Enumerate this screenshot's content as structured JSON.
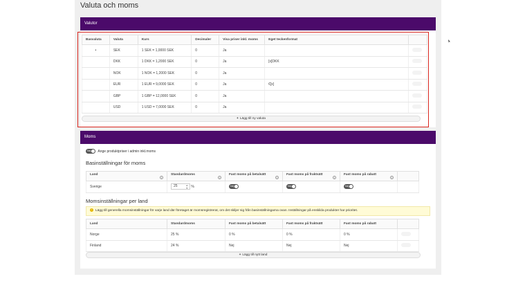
{
  "page": {
    "title": "Valuta och moms"
  },
  "valutor": {
    "header": "Valutor",
    "columns": [
      "Basvaluta",
      "Valuta",
      "Kurs",
      "Decimaler",
      "Visa priser inkl. moms",
      "Eget teckenformat"
    ],
    "rows": [
      {
        "base": "•",
        "currency": "SEK",
        "rate": "1 SEK = 1,0000 SEK",
        "decimals": "0",
        "incl_vat": "Ja",
        "format": ""
      },
      {
        "base": "",
        "currency": "DKK",
        "rate": "1 DKK = 1,2000 SEK",
        "decimals": "0",
        "incl_vat": "Ja",
        "format": "[x]DKK"
      },
      {
        "base": "",
        "currency": "NOK",
        "rate": "1 NOK = 1,2000 SEK",
        "decimals": "0",
        "incl_vat": "Ja",
        "format": ""
      },
      {
        "base": "",
        "currency": "EUR",
        "rate": "1 EUR = 9,0000 SEK",
        "decimals": "0",
        "incl_vat": "Ja",
        "format": "€[x]"
      },
      {
        "base": "",
        "currency": "GBP",
        "rate": "1 GBP = 12,0000 SEK",
        "decimals": "0",
        "incl_vat": "Ja",
        "format": ""
      },
      {
        "base": "",
        "currency": "USD",
        "rate": "1 USD = 7,0000 SEK",
        "decimals": "0",
        "incl_vat": "Ja",
        "format": ""
      }
    ],
    "add_label": "Lägg till ny valuta"
  },
  "moms": {
    "header": "Moms",
    "toggle_label": "Nej",
    "toggle_text": "Ange produktpriser i admin inkl.moms",
    "basic": {
      "title": "Basinställningar för moms",
      "columns": [
        "Land",
        "Standardmoms",
        "Fast moms på betalsätt",
        "Fast moms på fraktsätt",
        "Fast moms på rabatt"
      ],
      "country": "Sverige",
      "standard_value": "25",
      "percent": "%",
      "toggle_label": "Nej"
    },
    "per_country": {
      "title": "Momsinställningar per land",
      "notice": "Lägg till generella momsinställningar för varje land där företaget är momsregistrerat, om det skiljer sig från basinställningarna ovan. Inställningar på enskilda produkter har prioritet.",
      "columns": [
        "Land",
        "Standardmoms",
        "Fast moms på betalsätt",
        "Fast moms på fraktsätt",
        "Fast moms på rabatt"
      ],
      "rows": [
        {
          "country": "Norge",
          "standard": "25 %",
          "payment": "0 %",
          "shipping": "0 %",
          "discount": "0 %"
        },
        {
          "country": "Finland",
          "standard": "24 %",
          "payment": "Nej",
          "shipping": "Nej",
          "discount": "Nej"
        }
      ],
      "add_label": "Lägg till nytt land"
    }
  },
  "icons": {
    "info": "info-icon",
    "notice": "warning-icon",
    "plus": "plus-icon",
    "drag": "drag-handle-icon"
  },
  "colors": {
    "header": "#4b0a6a",
    "highlight": "#d9251d",
    "notice_bg": "#fffbd6"
  }
}
